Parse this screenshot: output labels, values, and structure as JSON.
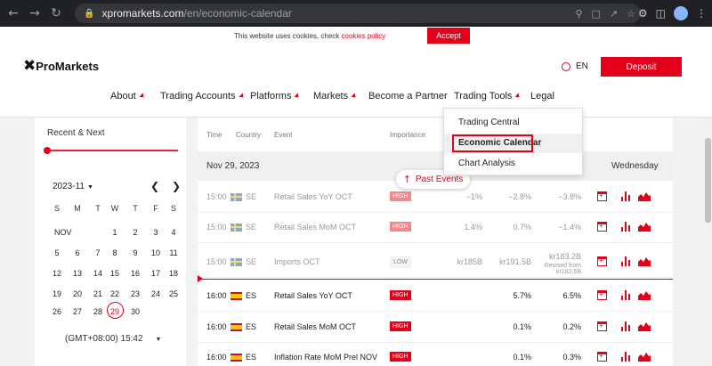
{
  "browser": {
    "url_domain": "xpromarkets.com",
    "url_path": "/en/economic-calendar"
  },
  "cookie": {
    "text": "This website uses cookies, check ",
    "link": "cookies policy",
    "accept": "Accept"
  },
  "header": {
    "brand": "ProMarkets",
    "language": "EN",
    "deposit": "Deposit"
  },
  "nav": {
    "about": "About",
    "trading_accounts": "Trading Accounts",
    "platforms": "Platforms",
    "markets": "Markets",
    "partner": "Become a Partner",
    "trading_tools": "Trading Tools",
    "legal": "Legal"
  },
  "dropdown": {
    "items": [
      "Trading Central",
      "Economic Calendar",
      "Chart Analysis"
    ]
  },
  "sidebar": {
    "label": "Recent & Next",
    "month": "2023-11",
    "dow": [
      "S",
      "M",
      "T",
      "W",
      "T",
      "F",
      "S"
    ],
    "month_abbr": "NOV",
    "days": [
      [
        "",
        "",
        "",
        "1",
        "2",
        "3",
        "4"
      ],
      [
        "5",
        "6",
        "7",
        "8",
        "9",
        "10",
        "11"
      ],
      [
        "12",
        "13",
        "14",
        "15",
        "16",
        "17",
        "18"
      ],
      [
        "19",
        "20",
        "21",
        "22",
        "23",
        "24",
        "25"
      ],
      [
        "26",
        "27",
        "28",
        "29",
        "30",
        "",
        ""
      ]
    ],
    "today": "29",
    "timezone": "(GMT+08:00) 15:42"
  },
  "table": {
    "headers": {
      "time": "Time",
      "country": "Country",
      "event": "Event",
      "importance": "Importance"
    },
    "date": "Nov 29, 2023",
    "weekday": "Wednesday",
    "past_events": "Past Events",
    "rows": [
      {
        "time": "15:00",
        "country": "SE",
        "event": "Retail Sales YoY OCT",
        "importance": "HIGH",
        "actual": "−1%",
        "forecast": "−2.8%",
        "previous": "−3.8%",
        "revised": ""
      },
      {
        "time": "15:00",
        "country": "SE",
        "event": "Retail Sales MoM OCT",
        "importance": "HIGH",
        "actual": "1.4%",
        "forecast": "0.7%",
        "previous": "−1.4%",
        "revised": ""
      },
      {
        "time": "15:00",
        "country": "SE",
        "event": "Imports OCT",
        "importance": "LOW",
        "actual": "kr185B",
        "forecast": "kr191.5B",
        "previous": "kr183.2B",
        "revised": "Revised from kr182.6B"
      },
      {
        "time": "16:00",
        "country": "ES",
        "event": "Retail Sales YoY OCT",
        "importance": "HIGH",
        "actual": "",
        "forecast": "5.7%",
        "previous": "6.5%",
        "revised": ""
      },
      {
        "time": "16:00",
        "country": "ES",
        "event": "Retail Sales MoM OCT",
        "importance": "HIGH",
        "actual": "",
        "forecast": "0.1%",
        "previous": "0.2%",
        "revised": ""
      },
      {
        "time": "16:00",
        "country": "ES",
        "event": "Inflation Rate MoM Prel NOV",
        "importance": "HIGH",
        "actual": "",
        "forecast": "0.1%",
        "previous": "0.3%",
        "revised": ""
      }
    ]
  },
  "colors": {
    "accent": "#e2001a",
    "past_text": "#999999"
  }
}
